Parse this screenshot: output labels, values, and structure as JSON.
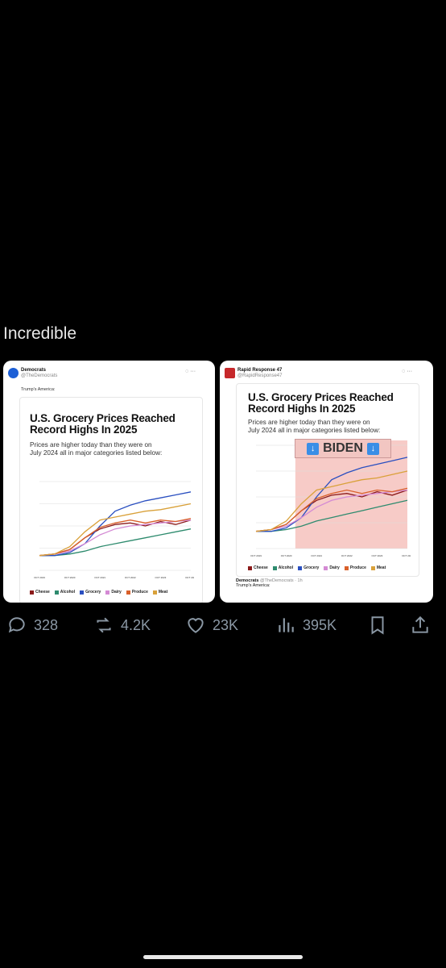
{
  "caption": "Incredible",
  "left_post": {
    "author": "Democrats",
    "handle": "@TheDemocrats",
    "text": "Trump's America:"
  },
  "right_post": {
    "author": "Rapid Response 47",
    "handle": "@RapidResponse47",
    "overlay_label": "BIDEN",
    "quoted_author": "Democrats",
    "quoted_handle": "@TheDemocrats · 1h",
    "quoted_text": "Trump's America:"
  },
  "graphic": {
    "title_line1": "U.S. Grocery Prices Reached",
    "title_line2": "Record Highs In 2025",
    "subtitle_line1": "Prices are higher today than they were on",
    "subtitle_line2": "July 2024 all in major categories listed below:"
  },
  "chart_data": {
    "type": "line",
    "x": [
      "OCT 2019",
      "OCT 2020",
      "OCT 2021",
      "OCT 2022",
      "OCT 2023",
      "OCT 2024"
    ],
    "series": [
      {
        "name": "Cheese",
        "color": "#8b1a1a",
        "values": [
          100,
          101,
          104,
          112,
          118,
          121,
          122,
          120,
          123,
          121,
          124
        ]
      },
      {
        "name": "Alcohol",
        "color": "#2e8b6e",
        "values": [
          100,
          100,
          101,
          103,
          106,
          108,
          110,
          112,
          114,
          116,
          118
        ]
      },
      {
        "name": "Grocery",
        "color": "#2a4fc0",
        "values": [
          100,
          100,
          102,
          108,
          120,
          130,
          134,
          137,
          139,
          141,
          143
        ]
      },
      {
        "name": "Dairy",
        "color": "#d48ad4",
        "values": [
          100,
          101,
          103,
          108,
          114,
          118,
          120,
          121,
          122,
          123,
          124
        ]
      },
      {
        "name": "Produce",
        "color": "#d9602a",
        "values": [
          100,
          101,
          104,
          112,
          119,
          122,
          124,
          122,
          124,
          123,
          125
        ]
      },
      {
        "name": "Meat",
        "color": "#d9a13a",
        "values": [
          100,
          101,
          106,
          116,
          124,
          126,
          128,
          130,
          131,
          133,
          135
        ]
      }
    ],
    "ylim": [
      90,
      150
    ]
  },
  "actions": {
    "replies": "328",
    "reposts": "4.2K",
    "likes": "23K",
    "views": "395K"
  }
}
